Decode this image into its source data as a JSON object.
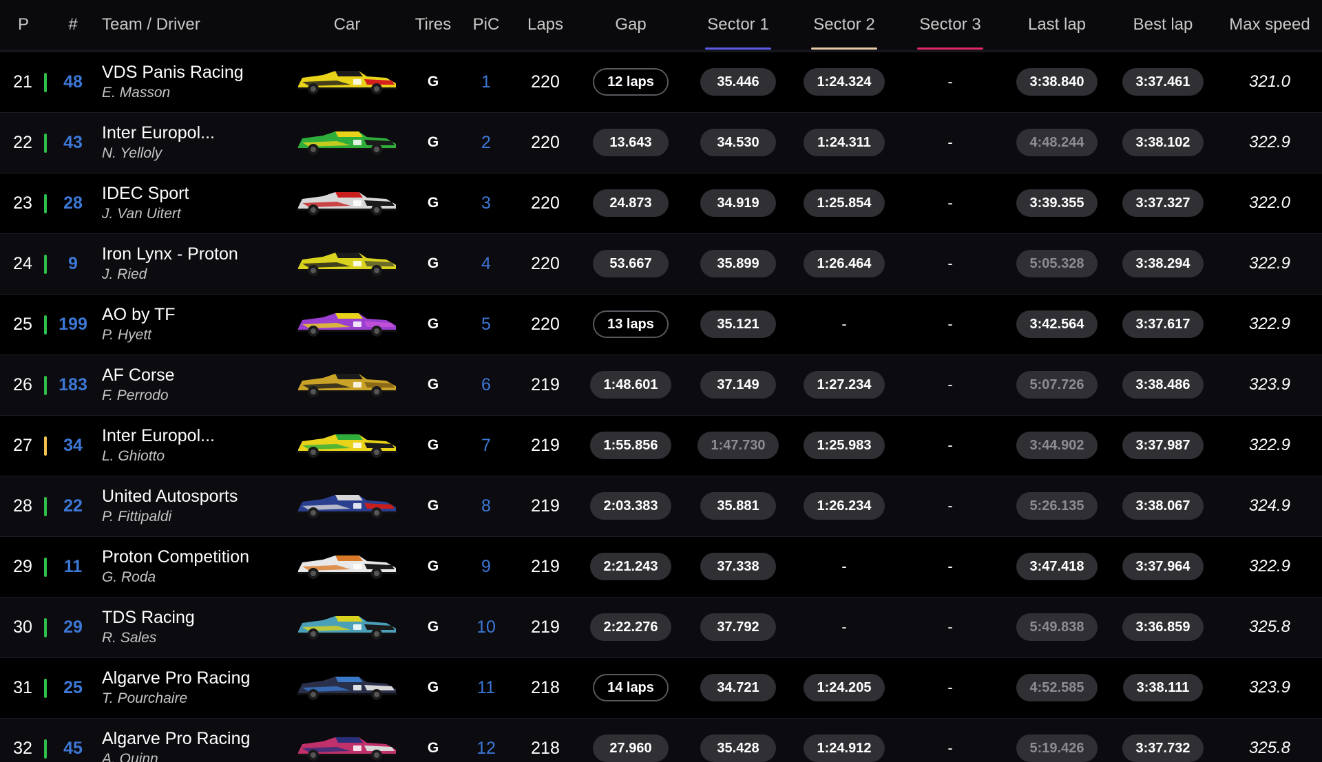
{
  "header": {
    "p": "P",
    "num": "#",
    "team": "Team / Driver",
    "car": "Car",
    "tires": "Tires",
    "pic": "PiC",
    "laps": "Laps",
    "gap": "Gap",
    "s1": "Sector 1",
    "s2": "Sector 2",
    "s3": "Sector 3",
    "last": "Last lap",
    "best": "Best lap",
    "speed": "Max speed"
  },
  "colors": {
    "sector1": "#5b5be6",
    "sector2": "#e8c9a8",
    "sector3": "#e02864",
    "flag_green": "#2fbf4a",
    "flag_yellow": "#f2c14e",
    "number_blue": "#3d78d6"
  },
  "rows": [
    {
      "pos": "21",
      "num": "48",
      "team": "VDS Panis Racing",
      "driver": "E. Masson",
      "car_colors": [
        "#e8d21a",
        "#1b1b1b",
        "#d62020"
      ],
      "tires": "G",
      "pic": "1",
      "laps": "220",
      "gap": "12 laps",
      "gap_style": "outline",
      "s1": "35.446",
      "s1_dim": false,
      "s2": "1:24.324",
      "s2_dim": false,
      "s3": "-",
      "last": "3:38.840",
      "last_dim": false,
      "best": "3:37.461",
      "speed": "321.0",
      "flag": "green"
    },
    {
      "pos": "22",
      "num": "43",
      "team": "Inter Europol...",
      "driver": "N. Yelloly",
      "car_colors": [
        "#2fae3c",
        "#e8d21a",
        "#1b1b1b"
      ],
      "tires": "G",
      "pic": "2",
      "laps": "220",
      "gap": "13.643",
      "gap_style": "fill",
      "s1": "34.530",
      "s1_dim": false,
      "s2": "1:24.311",
      "s2_dim": false,
      "s3": "-",
      "last": "4:48.244",
      "last_dim": true,
      "best": "3:38.102",
      "speed": "322.9",
      "flag": "green"
    },
    {
      "pos": "23",
      "num": "28",
      "team": "IDEC Sport",
      "driver": "J. Van Uitert",
      "car_colors": [
        "#d8d8d8",
        "#c81e1e",
        "#1b1b1b"
      ],
      "tires": "G",
      "pic": "3",
      "laps": "220",
      "gap": "24.873",
      "gap_style": "fill",
      "s1": "34.919",
      "s1_dim": false,
      "s2": "1:25.854",
      "s2_dim": false,
      "s3": "-",
      "last": "3:39.355",
      "last_dim": false,
      "best": "3:37.327",
      "speed": "322.0",
      "flag": "green"
    },
    {
      "pos": "24",
      "num": "9",
      "team": "Iron Lynx - Proton",
      "driver": "J. Ried",
      "car_colors": [
        "#d9d21e",
        "#1b1b1b",
        "#6b6b2a"
      ],
      "tires": "G",
      "pic": "4",
      "laps": "220",
      "gap": "53.667",
      "gap_style": "fill",
      "s1": "35.899",
      "s1_dim": false,
      "s2": "1:26.464",
      "s2_dim": false,
      "s3": "-",
      "last": "5:05.328",
      "last_dim": true,
      "best": "3:38.294",
      "speed": "322.9",
      "flag": "green"
    },
    {
      "pos": "25",
      "num": "199",
      "team": "AO by TF",
      "driver": "P. Hyett",
      "car_colors": [
        "#9a3fd0",
        "#e8d21a",
        "#c04fd8"
      ],
      "tires": "G",
      "pic": "5",
      "laps": "220",
      "gap": "13 laps",
      "gap_style": "outline",
      "s1": "35.121",
      "s1_dim": false,
      "s2": "-",
      "s2_dim": false,
      "s3": "-",
      "last": "3:42.564",
      "last_dim": false,
      "best": "3:37.617",
      "speed": "322.9",
      "flag": "green"
    },
    {
      "pos": "26",
      "num": "183",
      "team": "AF Corse",
      "driver": "F. Perrodo",
      "car_colors": [
        "#c9a227",
        "#1b1b1b",
        "#8a6a18"
      ],
      "tires": "G",
      "pic": "6",
      "laps": "219",
      "gap": "1:48.601",
      "gap_style": "fill",
      "s1": "37.149",
      "s1_dim": false,
      "s2": "1:27.234",
      "s2_dim": false,
      "s3": "-",
      "last": "5:07.726",
      "last_dim": true,
      "best": "3:38.486",
      "speed": "323.9",
      "flag": "green"
    },
    {
      "pos": "27",
      "num": "34",
      "team": "Inter Europol...",
      "driver": "L. Ghiotto",
      "car_colors": [
        "#e8d21a",
        "#2fae3c",
        "#1b1b1b"
      ],
      "tires": "G",
      "pic": "7",
      "laps": "219",
      "gap": "1:55.856",
      "gap_style": "fill",
      "s1": "1:47.730",
      "s1_dim": true,
      "s2": "1:25.983",
      "s2_dim": false,
      "s3": "-",
      "last": "3:44.902",
      "last_dim": true,
      "best": "3:37.987",
      "speed": "322.9",
      "flag": "yellow"
    },
    {
      "pos": "28",
      "num": "22",
      "team": "United Autosports",
      "driver": "P. Fittipaldi",
      "car_colors": [
        "#2a3f8f",
        "#d8d8d8",
        "#c81e1e"
      ],
      "tires": "G",
      "pic": "8",
      "laps": "219",
      "gap": "2:03.383",
      "gap_style": "fill",
      "s1": "35.881",
      "s1_dim": false,
      "s2": "1:26.234",
      "s2_dim": false,
      "s3": "-",
      "last": "5:26.135",
      "last_dim": true,
      "best": "3:38.067",
      "speed": "324.9",
      "flag": "green"
    },
    {
      "pos": "29",
      "num": "11",
      "team": "Proton Competition",
      "driver": "G. Roda",
      "car_colors": [
        "#e8e8e8",
        "#d97a2a",
        "#1b1b1b"
      ],
      "tires": "G",
      "pic": "9",
      "laps": "219",
      "gap": "2:21.243",
      "gap_style": "fill",
      "s1": "37.338",
      "s1_dim": false,
      "s2": "-",
      "s2_dim": false,
      "s3": "-",
      "last": "3:47.418",
      "last_dim": false,
      "best": "3:37.964",
      "speed": "322.9",
      "flag": "green"
    },
    {
      "pos": "30",
      "num": "29",
      "team": "TDS Racing",
      "driver": "R. Sales",
      "car_colors": [
        "#4aa0b8",
        "#d9d21e",
        "#1b1b1b"
      ],
      "tires": "G",
      "pic": "10",
      "laps": "219",
      "gap": "2:22.276",
      "gap_style": "fill",
      "s1": "37.792",
      "s1_dim": false,
      "s2": "-",
      "s2_dim": false,
      "s3": "-",
      "last": "5:49.838",
      "last_dim": true,
      "best": "3:36.859",
      "speed": "325.8",
      "flag": "green"
    },
    {
      "pos": "31",
      "num": "25",
      "team": "Algarve Pro Racing",
      "driver": "T. Pourchaire",
      "car_colors": [
        "#2a2f4a",
        "#3a78c8",
        "#d8d8d8"
      ],
      "tires": "G",
      "pic": "11",
      "laps": "218",
      "gap": "14 laps",
      "gap_style": "outline",
      "s1": "34.721",
      "s1_dim": false,
      "s2": "1:24.205",
      "s2_dim": false,
      "s3": "-",
      "last": "4:52.585",
      "last_dim": true,
      "best": "3:38.111",
      "speed": "323.9",
      "flag": "green"
    },
    {
      "pos": "32",
      "num": "45",
      "team": "Algarve Pro Racing",
      "driver": "A. Quinn",
      "car_colors": [
        "#c0306a",
        "#2a2f7a",
        "#d8d8d8"
      ],
      "tires": "G",
      "pic": "12",
      "laps": "218",
      "gap": "27.960",
      "gap_style": "fill",
      "s1": "35.428",
      "s1_dim": false,
      "s2": "1:24.912",
      "s2_dim": false,
      "s3": "-",
      "last": "5:19.426",
      "last_dim": true,
      "best": "3:37.732",
      "speed": "325.8",
      "flag": "green"
    }
  ]
}
